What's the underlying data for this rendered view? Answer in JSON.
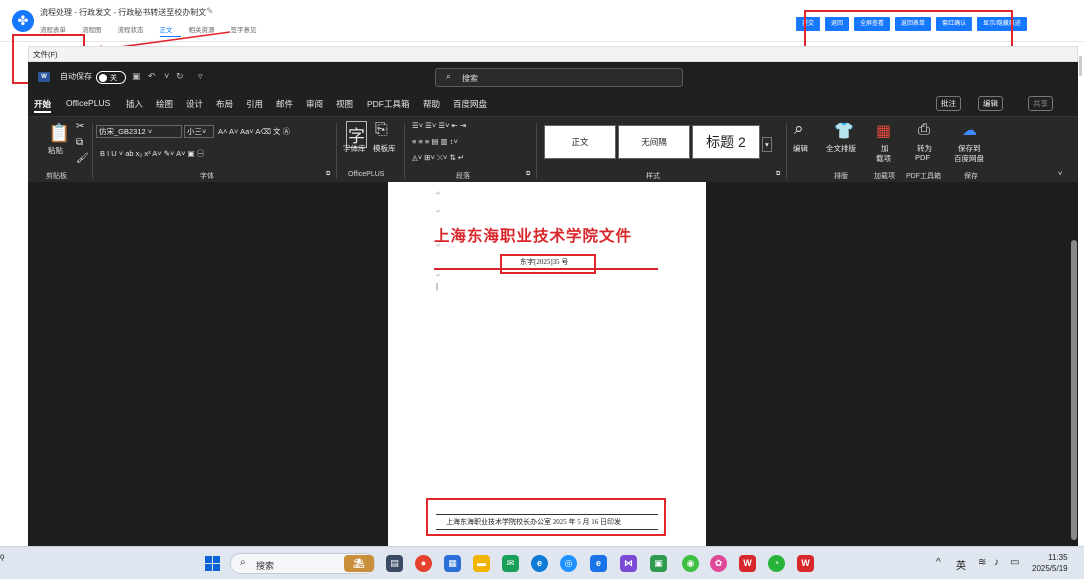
{
  "header": {
    "title": "流程处理 - 行政发文 - 行政秘书转送至校办制文",
    "tabs": [
      "流程表单",
      "流程图",
      "流程状态",
      "正文",
      "相关资源",
      "签字意见"
    ],
    "active_tab": "正文",
    "buttons": [
      "提交",
      "退回",
      "全屏查看",
      "返回表单",
      "套红确认",
      "显示/隐藏痕迹"
    ]
  },
  "word": {
    "file_menu": "文件(F)",
    "autosave_label": "自动保存",
    "autosave_state": "关",
    "search_placeholder": "搜索",
    "menus": [
      "开始",
      "OfficePLUS",
      "插入",
      "绘图",
      "设计",
      "布局",
      "引用",
      "邮件",
      "审阅",
      "视图",
      "PDF工具箱",
      "帮助",
      "百度网盘"
    ],
    "right_buttons": [
      "批注",
      "编辑",
      "共享"
    ],
    "ribbon": {
      "paste_label": "粘贴",
      "font_name": "仿宋_GB2312",
      "font_size": "小三",
      "font_tools": [
        "字体库",
        "模板库"
      ],
      "styles": [
        "正文",
        "无间隔",
        "标题 2"
      ],
      "edit_label": "编辑",
      "layout_label": "全文排版",
      "addin_label": "加\n载项",
      "addin_line1": "加",
      "addin_line2": "载项",
      "pdf_line1": "转为",
      "pdf_line2": "PDF",
      "save_line1": "保存到",
      "save_line2": "百度网盘",
      "groups": [
        "剪贴板",
        "字体",
        "OfficePLUS",
        "段落",
        "样式",
        "排版",
        "加载项",
        "PDF工具箱",
        "保存"
      ]
    }
  },
  "document": {
    "heading": "上海东海职业技术学院文件",
    "doc_number": "东字[2025]35 号",
    "footer": "上海东海职业技术学院校长办公室   2025 年 5 月 16 日印发"
  },
  "taskbar": {
    "search_placeholder": "搜索",
    "left_text": "ǫ",
    "ime": "英",
    "time": "11:35",
    "date": "2025/5/19"
  }
}
